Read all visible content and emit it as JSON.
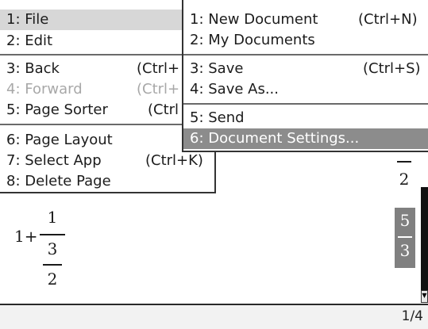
{
  "document": {
    "expression": {
      "whole": "1+",
      "outer_num": "1",
      "inner_num": "3",
      "inner_den": "2"
    },
    "side_top": {
      "den": "2"
    },
    "side_highlight": {
      "num": "5",
      "den": "3"
    },
    "page_indicator": "1/4"
  },
  "main_menu": {
    "items": [
      {
        "label": "1: File",
        "shortcut": "",
        "state": "selected"
      },
      {
        "label": "2: Edit",
        "shortcut": "",
        "state": "normal"
      },
      {
        "label": "3: Back",
        "shortcut": "(Ctrl+",
        "state": "normal"
      },
      {
        "label": "4: Forward",
        "shortcut": "(Ctrl+",
        "state": "disabled"
      },
      {
        "label": "5: Page Sorter",
        "shortcut": "(Ctrl",
        "state": "normal"
      },
      {
        "label": "6: Page Layout",
        "shortcut": "",
        "state": "normal"
      },
      {
        "label": "7: Select App",
        "shortcut": "(Ctrl+K)",
        "state": "normal"
      },
      {
        "label": "8: Delete Page",
        "shortcut": "",
        "state": "normal"
      }
    ]
  },
  "file_submenu": {
    "items": [
      {
        "label": "1: New Document",
        "shortcut": "(Ctrl+N)",
        "state": "normal"
      },
      {
        "label": "2: My Documents",
        "shortcut": "",
        "state": "normal"
      },
      {
        "label": "3: Save",
        "shortcut": "(Ctrl+S)",
        "state": "normal"
      },
      {
        "label": "4: Save As...",
        "shortcut": "",
        "state": "normal"
      },
      {
        "label": "5: Send",
        "shortcut": "",
        "state": "normal"
      },
      {
        "label": "6: Document Settings...",
        "shortcut": "",
        "state": "active"
      }
    ]
  },
  "icons": {
    "scroll_down": "chevron-down-icon"
  }
}
